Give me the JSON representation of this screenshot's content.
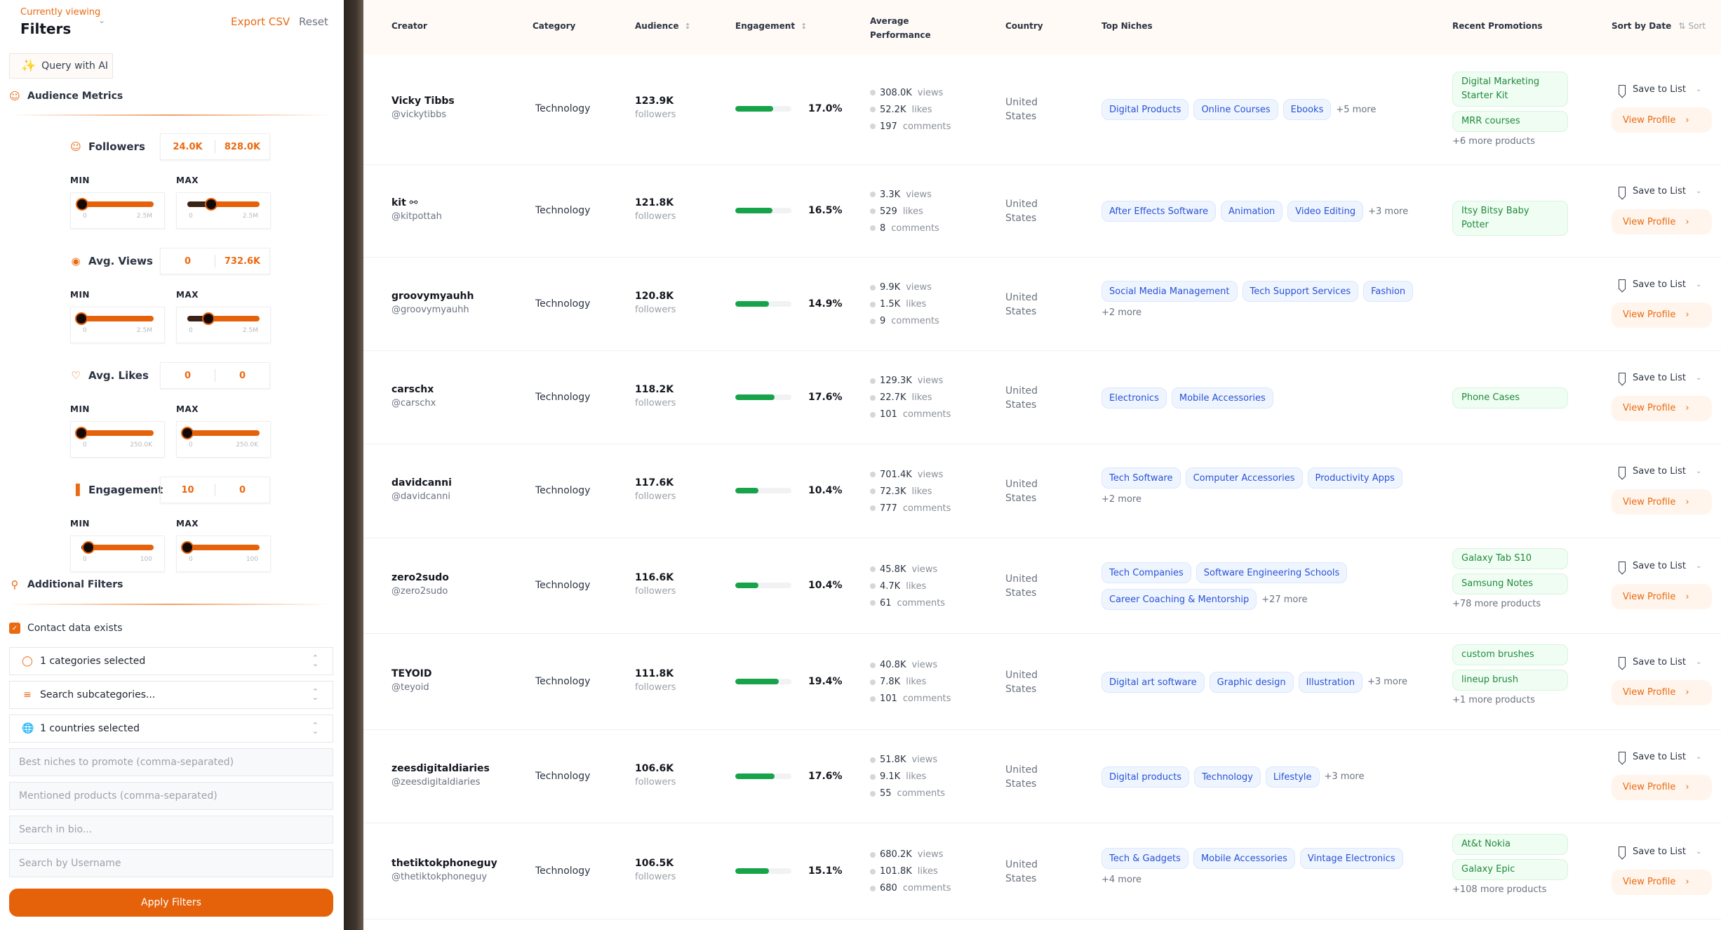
{
  "sidebar": {
    "eyebrow": "Currently viewing",
    "title": "Filters",
    "export_label": "Export CSV",
    "reset_label": "Reset",
    "ai_button_label": "Query with AI",
    "audience_metrics_title": "Audience Metrics",
    "metrics": [
      {
        "label": "Followers",
        "icon": "users-icon",
        "min_value": "24.0K",
        "max_value": "828.0K",
        "min_slider": {
          "value_fraction": 0.01,
          "tick_min": "0",
          "tick_max": "2.5M"
        },
        "max_slider": {
          "value_fraction": 0.33,
          "tick_min": "0",
          "tick_max": "2.5M"
        }
      },
      {
        "label": "Avg. Views",
        "icon": "eye-icon",
        "min_value": "0",
        "max_value": "732.6K",
        "min_slider": {
          "value_fraction": 0.0,
          "tick_min": "0",
          "tick_max": "2.5M"
        },
        "max_slider": {
          "value_fraction": 0.29,
          "tick_min": "0",
          "tick_max": "2.5M"
        }
      },
      {
        "label": "Avg. Likes",
        "icon": "heart-icon",
        "min_value": "0",
        "max_value": "0",
        "min_slider": {
          "value_fraction": 0.0,
          "tick_min": "0",
          "tick_max": "250.0K"
        },
        "max_slider": {
          "value_fraction": 0.0,
          "tick_min": "0",
          "tick_max": "250.0K"
        }
      },
      {
        "label": "Engagement",
        "icon": "bar-chart-icon",
        "min_value": "10",
        "max_value": "0",
        "min_slider": {
          "value_fraction": 0.1,
          "tick_min": "0",
          "tick_max": "100"
        },
        "max_slider": {
          "value_fraction": 0.0,
          "tick_min": "0",
          "tick_max": "100"
        }
      }
    ],
    "min_label": "MIN",
    "max_label": "MAX",
    "additional_filters_title": "Additional Filters",
    "contact_checkbox": {
      "label": "Contact data exists",
      "checked": true
    },
    "selects": [
      {
        "icon": "tag-icon",
        "value": "1 categories selected"
      },
      {
        "icon": "layers-icon",
        "value": "Search subcategories..."
      },
      {
        "icon": "globe-icon",
        "value": "1 countries selected"
      }
    ],
    "inputs": [
      {
        "placeholder": "Best niches to promote (comma-separated)",
        "value": ""
      },
      {
        "placeholder": "Mentioned products (comma-separated)",
        "value": ""
      },
      {
        "placeholder": "Search in bio...",
        "value": ""
      },
      {
        "placeholder": "Search by Username",
        "value": ""
      }
    ],
    "apply_label": "Apply Filters"
  },
  "table": {
    "headers": {
      "creator": "Creator",
      "category": "Category",
      "audience": "Audience",
      "engagement": "Engagement",
      "performance": "Average Performance",
      "country": "Country",
      "niches": "Top Niches",
      "promotions": "Recent Promotions",
      "sort_by_date": "Sort by Date",
      "sort": "Sort"
    },
    "labels": {
      "followers": "followers",
      "views": "views",
      "likes": "likes",
      "comments": "comments",
      "save_to_list": "Save to List",
      "view_profile": "View Profile"
    },
    "engagement_scale_max_percent": 25,
    "rows": [
      {
        "name": "Vicky Tibbs",
        "handle": "@vickytibbs",
        "category": "Technology",
        "followers": "123.9K",
        "engagement": "17.0%",
        "engagement_value": 17.0,
        "views": "308.0K",
        "likes": "52.2K",
        "comments": "197",
        "country": "United States",
        "niches": [
          "Digital Products",
          "Online Courses",
          "Ebooks"
        ],
        "niches_more": "+5 more",
        "promotions": [
          "Digital Marketing Starter Kit",
          "MRR courses"
        ],
        "promotions_more": "+6 more products"
      },
      {
        "name": "kit ⚯",
        "handle": "@kitpottah",
        "category": "Technology",
        "followers": "121.8K",
        "engagement": "16.5%",
        "engagement_value": 16.5,
        "views": "3.3K",
        "likes": "529",
        "comments": "8",
        "country": "United States",
        "niches": [
          "After Effects Software",
          "Animation",
          "Video Editing"
        ],
        "niches_more": "+3 more",
        "promotions": [
          "Itsy Bitsy Baby Potter"
        ],
        "promotions_more": ""
      },
      {
        "name": "groovymyauhh",
        "handle": "@groovymyauhh",
        "category": "Technology",
        "followers": "120.8K",
        "engagement": "14.9%",
        "engagement_value": 14.9,
        "views": "9.9K",
        "likes": "1.5K",
        "comments": "9",
        "country": "United States",
        "niches": [
          "Social Media Management",
          "Tech Support Services",
          "Fashion"
        ],
        "niches_more": "+2 more",
        "promotions": [],
        "promotions_more": ""
      },
      {
        "name": "carschx",
        "handle": "@carschx",
        "category": "Technology",
        "followers": "118.2K",
        "engagement": "17.6%",
        "engagement_value": 17.6,
        "views": "129.3K",
        "likes": "22.7K",
        "comments": "101",
        "country": "United States",
        "niches": [
          "Electronics",
          "Mobile Accessories"
        ],
        "niches_more": "",
        "promotions": [
          "Phone Cases"
        ],
        "promotions_more": ""
      },
      {
        "name": "davidcanni",
        "handle": "@davidcanni",
        "category": "Technology",
        "followers": "117.6K",
        "engagement": "10.4%",
        "engagement_value": 10.4,
        "views": "701.4K",
        "likes": "72.3K",
        "comments": "777",
        "country": "United States",
        "niches": [
          "Tech Software",
          "Computer Accessories",
          "Productivity Apps"
        ],
        "niches_more": "+2 more",
        "promotions": [],
        "promotions_more": ""
      },
      {
        "name": "zero2sudo",
        "handle": "@zero2sudo",
        "category": "Technology",
        "followers": "116.6K",
        "engagement": "10.4%",
        "engagement_value": 10.4,
        "views": "45.8K",
        "likes": "4.7K",
        "comments": "61",
        "country": "United States",
        "niches": [
          "Tech Companies",
          "Software Engineering Schools",
          "Career Coaching & Mentorship"
        ],
        "niches_more": "+27 more",
        "promotions": [
          "Galaxy Tab S10",
          "Samsung Notes"
        ],
        "promotions_more": "+78 more products"
      },
      {
        "name": "TEYOID",
        "handle": "@teyoid",
        "category": "Technology",
        "followers": "111.8K",
        "engagement": "19.4%",
        "engagement_value": 19.4,
        "views": "40.8K",
        "likes": "7.8K",
        "comments": "101",
        "country": "United States",
        "niches": [
          "Digital art software",
          "Graphic design",
          "Illustration"
        ],
        "niches_more": "+3 more",
        "promotions": [
          "custom brushes",
          "lineup brush"
        ],
        "promotions_more": "+1 more products"
      },
      {
        "name": "zeesdigitaldiaries",
        "handle": "@zeesdigitaldiaries",
        "category": "Technology",
        "followers": "106.6K",
        "engagement": "17.6%",
        "engagement_value": 17.6,
        "views": "51.8K",
        "likes": "9.1K",
        "comments": "55",
        "country": "United States",
        "niches": [
          "Digital products",
          "Technology",
          "Lifestyle"
        ],
        "niches_more": "+3 more",
        "promotions": [],
        "promotions_more": ""
      },
      {
        "name": "thetiktokphoneguy",
        "handle": "@thetiktokphoneguy",
        "category": "Technology",
        "followers": "106.5K",
        "engagement": "15.1%",
        "engagement_value": 15.1,
        "views": "680.2K",
        "likes": "101.8K",
        "comments": "680",
        "country": "United States",
        "niches": [
          "Tech & Gadgets",
          "Mobile Accessories",
          "Vintage Electronics"
        ],
        "niches_more": "+4 more",
        "promotions": [
          "At&t Nokia",
          "Galaxy Epic"
        ],
        "promotions_more": "+108 more products"
      }
    ]
  }
}
